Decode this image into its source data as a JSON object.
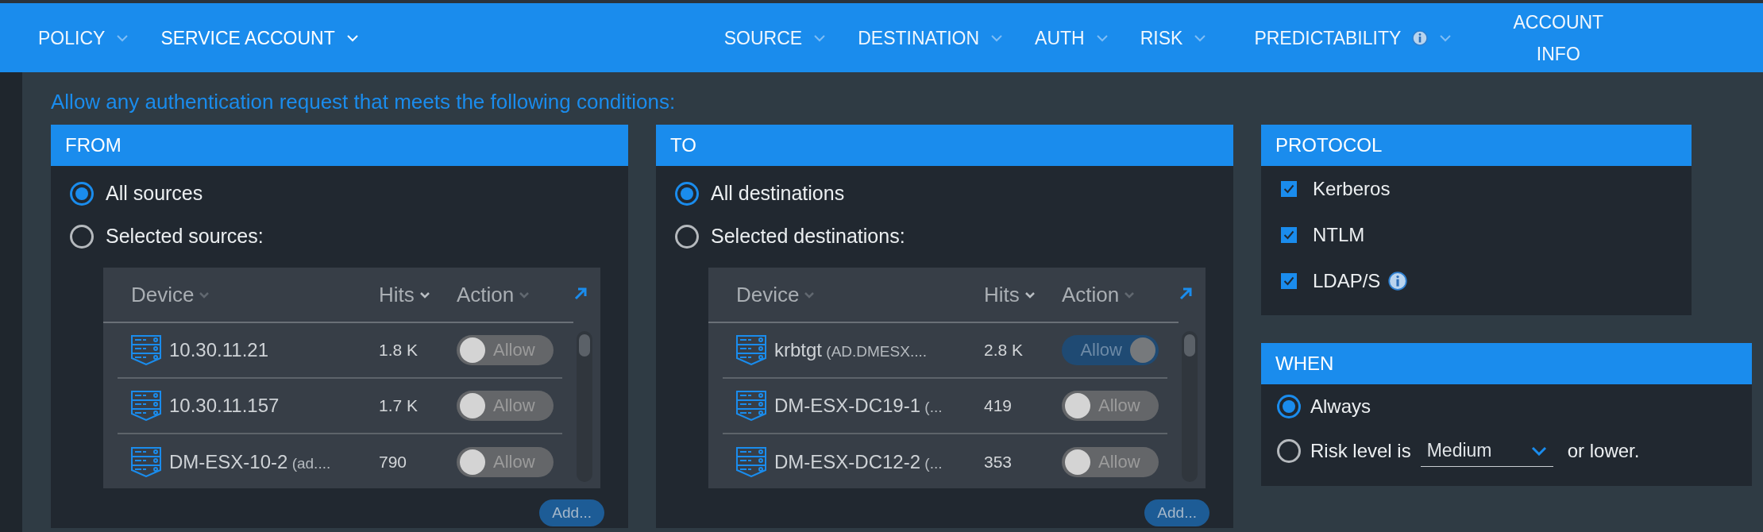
{
  "nav": [
    {
      "label": "POLICY",
      "kind": "menu",
      "selected": false
    },
    {
      "label": "SERVICE ACCOUNT",
      "kind": "menu",
      "selected": true
    },
    {
      "label": "SOURCE",
      "kind": "menu",
      "selected": false
    },
    {
      "label": "DESTINATION",
      "kind": "menu",
      "selected": false
    },
    {
      "label": "AUTH",
      "kind": "menu",
      "selected": false
    },
    {
      "label": "RISK",
      "kind": "menu",
      "selected": false
    },
    {
      "label": "PREDICTABILITY",
      "kind": "info-menu",
      "selected": false
    },
    {
      "label": "ACCOUNT INFO",
      "kind": "plain",
      "selected": false
    }
  ],
  "heading": "Allow any authentication request that meets the following conditions:",
  "panels": [
    {
      "title": "FROM",
      "options": [
        {
          "label": "All sources",
          "selected": true
        },
        {
          "label": "Selected sources:",
          "selected": false
        }
      ],
      "table": {
        "columns": [
          {
            "label": "Device",
            "sorted": false
          },
          {
            "label": "Hits",
            "sorted": true
          },
          {
            "label": "Action",
            "sorted": false
          }
        ],
        "rows": [
          {
            "name": "10.30.11.21",
            "detail": "",
            "hits": "1.8 K",
            "action": "Allow",
            "on": false
          },
          {
            "name": "10.30.11.157",
            "detail": "",
            "hits": "1.7 K",
            "action": "Allow",
            "on": false
          },
          {
            "name": "DM-ESX-10-2",
            "detail": "(ad....",
            "hits": "790",
            "action": "Allow",
            "on": false
          }
        ]
      },
      "add_button": "Add..."
    },
    {
      "title": "TO",
      "options": [
        {
          "label": "All destinations",
          "selected": true
        },
        {
          "label": "Selected destinations:",
          "selected": false
        }
      ],
      "table": {
        "columns": [
          {
            "label": "Device",
            "sorted": false
          },
          {
            "label": "Hits",
            "sorted": true
          },
          {
            "label": "Action",
            "sorted": false
          }
        ],
        "rows": [
          {
            "name": "krbtgt",
            "detail": "(AD.DMESX....",
            "hits": "2.8 K",
            "action": "Allow",
            "on": true
          },
          {
            "name": "DM-ESX-DC19-1",
            "detail": "(...",
            "hits": "419",
            "action": "Allow",
            "on": false
          },
          {
            "name": "DM-ESX-DC12-2",
            "detail": "(...",
            "hits": "353",
            "action": "Allow",
            "on": false
          }
        ]
      },
      "add_button": "Add..."
    }
  ],
  "protocol": {
    "title": "PROTOCOL",
    "items": [
      {
        "label": "Kerberos",
        "checked": true,
        "info": false
      },
      {
        "label": "NTLM",
        "checked": true,
        "info": false
      },
      {
        "label": "LDAP/S",
        "checked": true,
        "info": true
      }
    ]
  },
  "when": {
    "title": "WHEN",
    "options": [
      {
        "kind": "plain",
        "label": "Always",
        "selected": true
      },
      {
        "kind": "risk",
        "label": "Risk level is",
        "value": "Medium",
        "suffix": "or lower.",
        "selected": false
      }
    ]
  }
}
